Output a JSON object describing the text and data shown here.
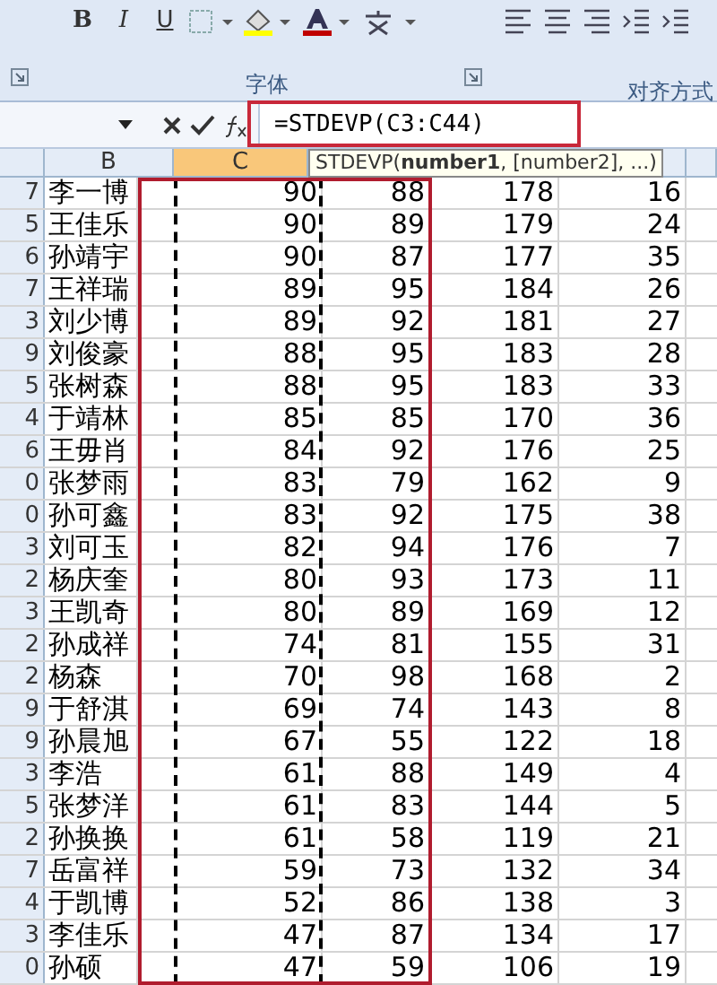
{
  "ribbon": {
    "font_buttons": [
      "B",
      "I",
      "U"
    ],
    "groups": [
      {
        "label": "字体"
      },
      {
        "label": "对齐方式"
      }
    ]
  },
  "formula_bar": {
    "formula": "=STDEVP(C3:C44)",
    "tooltip": "STDEVP(**number1**, [number2], ...)"
  },
  "columns": [
    {
      "label": "B",
      "selected": false
    },
    {
      "label": "C",
      "selected": true
    }
  ],
  "rows": [
    {
      "row_number": "7",
      "cells": [
        "李一博",
        "90",
        "88",
        "178",
        "16"
      ]
    },
    {
      "row_number": "5",
      "cells": [
        "王佳乐",
        "90",
        "89",
        "179",
        "24"
      ]
    },
    {
      "row_number": "6",
      "cells": [
        "孙靖宇",
        "90",
        "87",
        "177",
        "35"
      ]
    },
    {
      "row_number": "7",
      "cells": [
        "王祥瑞",
        "89",
        "95",
        "184",
        "26"
      ]
    },
    {
      "row_number": "3",
      "cells": [
        "刘少博",
        "89",
        "92",
        "181",
        "27"
      ]
    },
    {
      "row_number": "9",
      "cells": [
        "刘俊豪",
        "88",
        "95",
        "183",
        "28"
      ]
    },
    {
      "row_number": "5",
      "cells": [
        "张树森",
        "88",
        "95",
        "183",
        "33"
      ]
    },
    {
      "row_number": "4",
      "cells": [
        "于靖林",
        "85",
        "85",
        "170",
        "36"
      ]
    },
    {
      "row_number": "6",
      "cells": [
        "王毋肖",
        "84",
        "92",
        "176",
        "25"
      ]
    },
    {
      "row_number": "0",
      "cells": [
        "张梦雨",
        "83",
        "79",
        "162",
        "9"
      ]
    },
    {
      "row_number": "0",
      "cells": [
        "孙可鑫",
        "83",
        "92",
        "175",
        "38"
      ]
    },
    {
      "row_number": "3",
      "cells": [
        "刘可玉",
        "82",
        "94",
        "176",
        "7"
      ]
    },
    {
      "row_number": "2",
      "cells": [
        "杨庆奎",
        "80",
        "93",
        "173",
        "11"
      ]
    },
    {
      "row_number": "3",
      "cells": [
        "王凯奇",
        "80",
        "89",
        "169",
        "12"
      ]
    },
    {
      "row_number": "2",
      "cells": [
        "孙成祥",
        "74",
        "81",
        "155",
        "31"
      ]
    },
    {
      "row_number": "2",
      "cells": [
        "杨森",
        "70",
        "98",
        "168",
        "2"
      ]
    },
    {
      "row_number": "9",
      "cells": [
        "于舒淇",
        "69",
        "74",
        "143",
        "8"
      ]
    },
    {
      "row_number": "9",
      "cells": [
        "孙晨旭",
        "67",
        "55",
        "122",
        "18"
      ]
    },
    {
      "row_number": "3",
      "cells": [
        "李浩",
        "61",
        "88",
        "149",
        "4"
      ]
    },
    {
      "row_number": "5",
      "cells": [
        "张梦洋",
        "61",
        "83",
        "144",
        "5"
      ]
    },
    {
      "row_number": "2",
      "cells": [
        "孙换换",
        "61",
        "58",
        "119",
        "21"
      ]
    },
    {
      "row_number": "7",
      "cells": [
        "岳富祥",
        "59",
        "73",
        "132",
        "34"
      ]
    },
    {
      "row_number": "4",
      "cells": [
        "于凯博",
        "52",
        "86",
        "138",
        "3"
      ]
    },
    {
      "row_number": "3",
      "cells": [
        "李佳乐",
        "47",
        "87",
        "134",
        "17"
      ]
    },
    {
      "row_number": "0",
      "cells": [
        "孙硕",
        "47",
        "59",
        "106",
        "19"
      ]
    }
  ]
}
